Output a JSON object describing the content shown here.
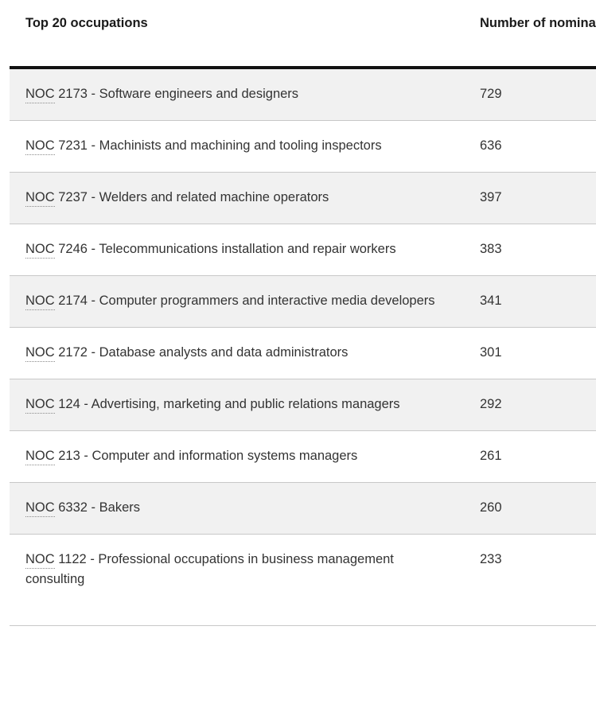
{
  "table": {
    "headers": {
      "occupation": "Top 20 occupations",
      "nominations": "Number of nominations"
    },
    "abbr_label": "NOC",
    "rows": [
      {
        "abbr": "NOC",
        "code": "2173",
        "occupation": "Software engineers and designers",
        "nominations": "729"
      },
      {
        "abbr": "NOC",
        "code": "7231",
        "occupation": "Machinists and machining and tooling inspectors",
        "nominations": "636"
      },
      {
        "abbr": "NOC",
        "code": "7237",
        "occupation": "Welders and related machine operators",
        "nominations": "397"
      },
      {
        "abbr": "NOC",
        "code": "7246",
        "occupation": "Telecommunications installation and repair workers",
        "nominations": "383"
      },
      {
        "abbr": "NOC",
        "code": "2174",
        "occupation": "Computer programmers and interactive media developers",
        "nominations": "341"
      },
      {
        "abbr": "NOC",
        "code": "2172",
        "occupation": "Database analysts and data administrators",
        "nominations": "301"
      },
      {
        "abbr": "NOC",
        "code": "124",
        "occupation": "Advertising, marketing and public relations managers",
        "nominations": "292"
      },
      {
        "abbr": "NOC",
        "code": "213",
        "occupation": "Computer and information systems managers",
        "nominations": "261"
      },
      {
        "abbr": "NOC",
        "code": "6332",
        "occupation": "Bakers",
        "nominations": "260"
      },
      {
        "abbr": "NOC",
        "code": "1122",
        "occupation": "Professional occupations in business management consulting",
        "nominations": "233"
      }
    ],
    "separator": " - "
  },
  "colors": {
    "row_shaded_background": "#f1f1f1",
    "row_background": "#ffffff",
    "row_border": "#c8c8c8",
    "header_rule": "#111111",
    "header_text": "#1a1a1a",
    "body_text": "#333333",
    "abbr_underline": "#8a8a8a"
  }
}
